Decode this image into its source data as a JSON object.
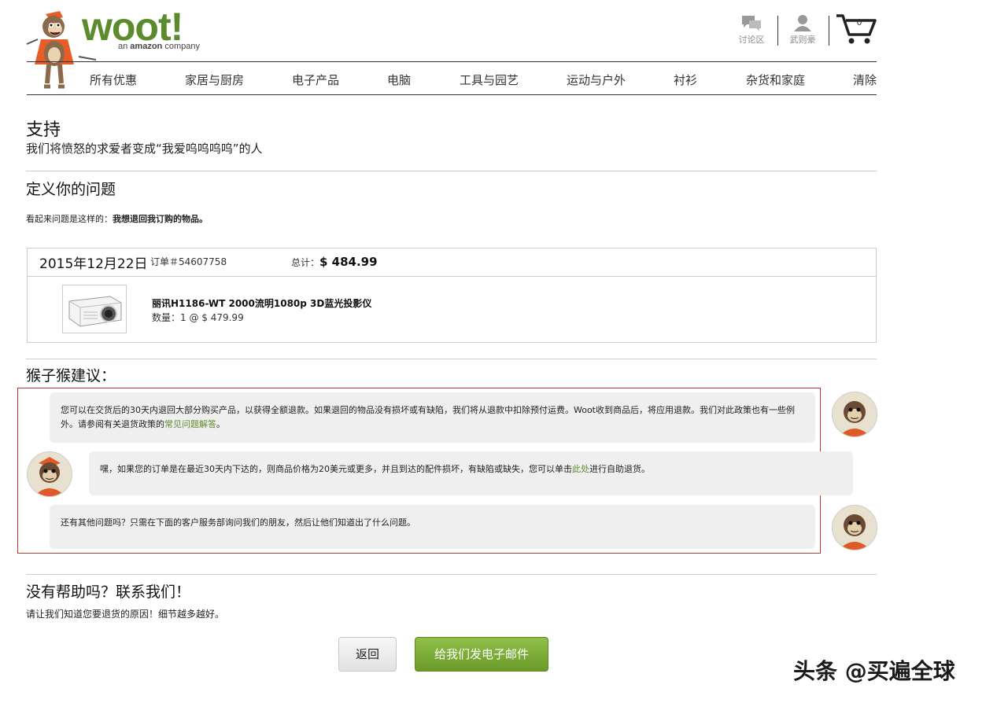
{
  "header": {
    "logo_word": "woot!",
    "logo_sub_prefix": "an ",
    "logo_sub_brand": "amazon",
    "logo_sub_suffix": " company",
    "forum_label": "讨论区",
    "account_label": "武则豪",
    "cart_count": "0",
    "brand_color": "#5b8b2c"
  },
  "nav": {
    "categories": [
      "所有优惠",
      "家居与厨房",
      "电子产品",
      "电脑",
      "工具与园艺",
      "运动与户外",
      "衬衫",
      "杂货和家庭",
      "清除"
    ]
  },
  "support": {
    "title": "支持",
    "subtitle": "我们将愤怒的求爱者变成“我爱呜呜呜呜”的人"
  },
  "define": {
    "title": "定义你的问题",
    "problem_prefix": "看起来问题是这样的：",
    "problem_value": "我想退回我订购的物品。"
  },
  "order": {
    "date": "2015年12月22日",
    "number_label": "订单＃54607758",
    "total_label": "总计：",
    "total_value": "$ 484.99",
    "product_name": "丽讯H1186-WT 2000流明1080p 3D蓝光投影仪",
    "product_qty": "数量：1 @ $ 479.99"
  },
  "advice": {
    "title": "猴子猴建议：",
    "bubble1_text": "您可以在交货后的30天内退回大部分购买产品，以获得全额退款。如果退回的物品没有损坏或有缺陷，我们将从退款中扣除预付运费。Woot收到商品后，将应用退款。我们对此政策也有一些例外。请参阅有关退货政策的",
    "bubble1_link": "常见问题解答",
    "bubble1_end": "。",
    "bubble2_text": "嘿，如果您的订单是在最近30天内下达的，则商品价格为20美元或更多，并且到达的配件损坏，有缺陷或缺失，您可以单击",
    "bubble2_link": "此处",
    "bubble2_end": "进行自助退货。",
    "bubble3_text": "还有其他问题吗？只需在下面的客户服务部询问我们的朋友，然后让他们知道出了什么问题。",
    "highlight_color": "#c0392b"
  },
  "contact": {
    "title": "没有帮助吗？联系我们！",
    "subtitle": "请让我们知道您要退货的原因！细节越多越好。",
    "back_label": "返回",
    "email_label": "给我们发电子邮件"
  },
  "watermark": "头条 @买遍全球"
}
